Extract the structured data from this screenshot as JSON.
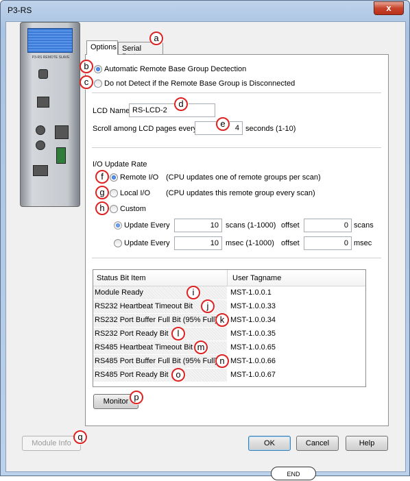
{
  "window": {
    "title": "P3-RS",
    "close_glyph": "x"
  },
  "device": {
    "label": "P3-RS REMOTE SLAVE"
  },
  "tabs": [
    {
      "label": "Options"
    },
    {
      "label": "Serial Ports"
    }
  ],
  "detection": {
    "auto_label": "Automatic Remote Base Group Dectection",
    "no_detect_label": "Do not Detect if the Remote Base Group is Disconnected",
    "selected": "auto"
  },
  "lcd": {
    "name_label": "LCD Name",
    "name_value": "RS-LCD-2",
    "scroll_label": "Scroll among LCD pages every",
    "scroll_value": "4",
    "scroll_units": "seconds (1-10)"
  },
  "io_update": {
    "group_label": "I/O Update Rate",
    "remote_label": "Remote I/O",
    "remote_desc": "(CPU updates one of remote groups per scan)",
    "local_label": "Local I/O",
    "local_desc": "(CPU updates this remote group every scan)",
    "custom_label": "Custom",
    "selected": "remote",
    "every_scans": {
      "label": "Update Every",
      "value": "10",
      "units": "scans (1-1000)",
      "offset_label": "offset",
      "offset_value": "0",
      "offset_units": "scans"
    },
    "every_msec": {
      "label": "Update Every",
      "value": "10",
      "units": "msec (1-1000)",
      "offset_label": "offset",
      "offset_value": "0",
      "offset_units": "msec"
    }
  },
  "status_table": {
    "headers": [
      "Status Bit Item",
      "User Tagname"
    ],
    "rows": [
      {
        "item": "Module Ready",
        "tag": "MST-1.0.0.1"
      },
      {
        "item": "RS232 Heartbeat Timeout Bit",
        "tag": "MST-1.0.0.33"
      },
      {
        "item": "RS232 Port Buffer Full Bit (95% Full)",
        "tag": "MST-1.0.0.34"
      },
      {
        "item": "RS232 Port Ready Bit",
        "tag": "MST-1.0.0.35"
      },
      {
        "item": "RS485 Heartbeat Timeout Bit",
        "tag": "MST-1.0.0.65"
      },
      {
        "item": "RS485 Port Buffer Full Bit (95% Full)",
        "tag": "MST-1.0.0.66"
      },
      {
        "item": "RS485 Port Ready Bit",
        "tag": "MST-1.0.0.67"
      }
    ]
  },
  "buttons": {
    "monitor": "Monitor",
    "module_info": "Module Info",
    "ok": "OK",
    "cancel": "Cancel",
    "help": "Help"
  },
  "callouts": [
    "a",
    "b",
    "c",
    "d",
    "e",
    "f",
    "g",
    "h",
    "i",
    "j",
    "k",
    "l",
    "m",
    "n",
    "o",
    "p",
    "q"
  ],
  "bottom_remnant": "END",
  "colors": {
    "callout_ring": "#dd2222",
    "title_bar": "#a9c3e2",
    "close_button": "#c7442b"
  }
}
